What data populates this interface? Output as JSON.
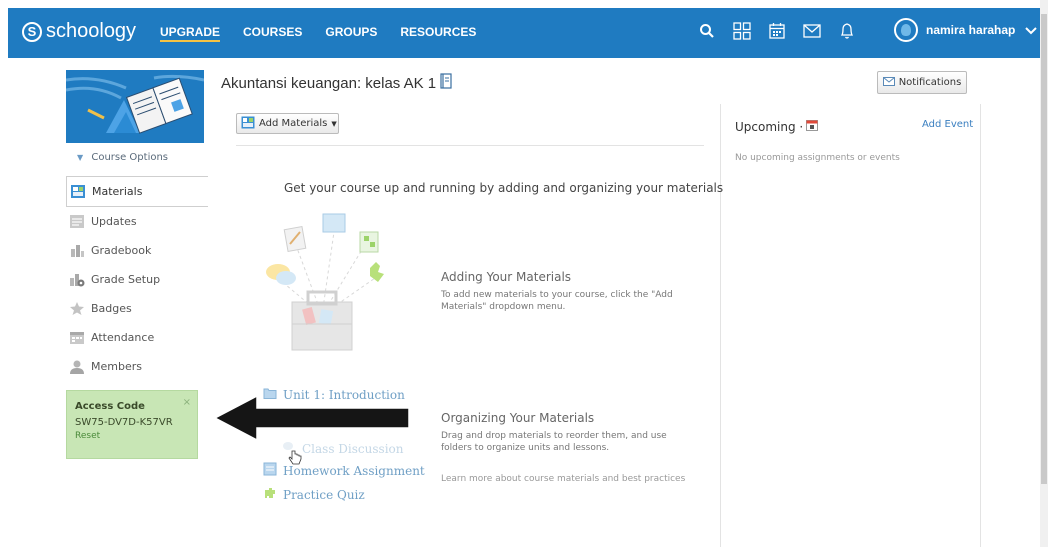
{
  "header": {
    "logo_text": "schoology",
    "logo_mark": "S",
    "nav": [
      "UPGRADE",
      "COURSES",
      "GROUPS",
      "RESOURCES"
    ],
    "icons": [
      "search-icon",
      "grid-icon",
      "calendar-icon",
      "mail-icon",
      "bell-icon"
    ],
    "user_name": "namira harahap",
    "accent_color": "#1f7bc1",
    "upgrade_underline_color": "#f5c243"
  },
  "sidebar": {
    "course_options": "Course Options",
    "items": [
      {
        "label": "Materials",
        "icon": "materials-icon",
        "active": true
      },
      {
        "label": "Updates",
        "icon": "updates-icon"
      },
      {
        "label": "Gradebook",
        "icon": "gradebook-icon"
      },
      {
        "label": "Grade Setup",
        "icon": "grade-setup-icon"
      },
      {
        "label": "Badges",
        "icon": "badge-icon"
      },
      {
        "label": "Attendance",
        "icon": "attendance-icon"
      },
      {
        "label": "Members",
        "icon": "members-icon"
      }
    ],
    "access": {
      "title": "Access Code",
      "code": "SW75-DV7D-K57VR",
      "reset": "Reset",
      "close": "×",
      "background": "#c8e6b5"
    }
  },
  "main": {
    "title": "Akuntansi keuangan: kelas AK 1",
    "notifications_label": "Notifications",
    "add_materials_label": "Add Materials",
    "heading": "Get your course up and running by adding and organizing your materials",
    "adding": {
      "title": "Adding Your Materials",
      "text": "To add new materials to your course, click the \"Add Materials\" dropdown menu."
    },
    "organizing": {
      "title": "Organizing Your Materials",
      "text": "Drag and drop materials to reorder them, and use folders to organize units and lessons."
    },
    "learn_more": "Learn more about course materials and best practices",
    "sample_materials": [
      {
        "label": "Unit 1: Introduction",
        "icon": "folder-icon"
      },
      {
        "label": "Class Discussion",
        "icon": "discussion-icon"
      },
      {
        "label": "Homework Assignment",
        "icon": "assignment-icon"
      },
      {
        "label": "Practice Quiz",
        "icon": "quiz-icon"
      }
    ]
  },
  "upcoming": {
    "title": "Upcoming ·",
    "add_event": "Add Event",
    "empty": "No upcoming assignments or events"
  }
}
